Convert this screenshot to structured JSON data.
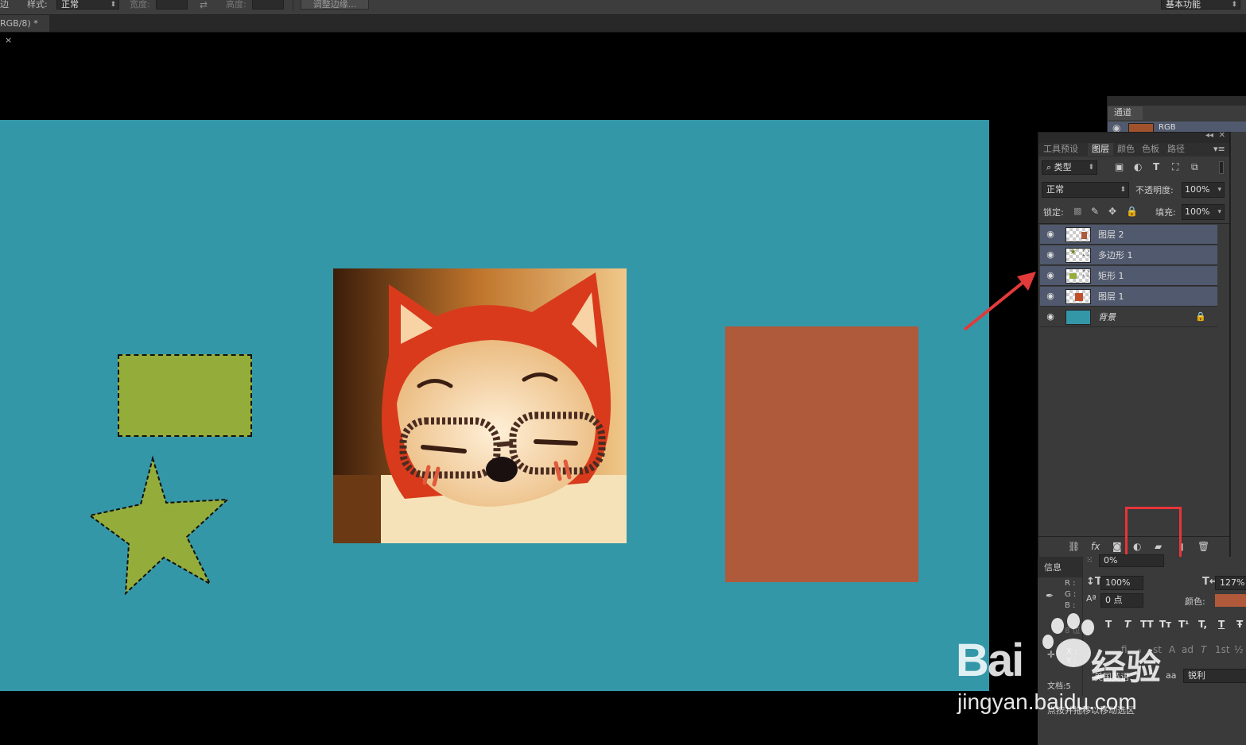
{
  "options_bar": {
    "fragment_left": "边",
    "style_label": "样式:",
    "style_value": "正常",
    "width_label": "宽度:",
    "height_label": "高度:",
    "refine_edge_button": "调整边缘...",
    "workspace_value": "基本功能"
  },
  "document_tab": {
    "title": "RGB/8) *",
    "close": "×"
  },
  "channels_panel": {
    "tab": "通道",
    "row_label": "RGB"
  },
  "layers_panel": {
    "tabs": [
      "工具预设",
      "图层",
      "颜色",
      "色板",
      "路径"
    ],
    "filter_label": "类型",
    "blend_mode": "正常",
    "opacity_label": "不透明度:",
    "opacity_value": "100%",
    "lock_label": "锁定:",
    "fill_label": "填充:",
    "fill_value": "100%",
    "layers": [
      {
        "name": "图层 2",
        "selected": true
      },
      {
        "name": "多边形 1",
        "selected": true
      },
      {
        "name": "矩形 1",
        "selected": true
      },
      {
        "name": "图层 1",
        "selected": true
      },
      {
        "name": "背景",
        "selected": false,
        "locked": true
      }
    ],
    "bottom_icons": [
      "link-icon",
      "fx-icon",
      "mask-icon",
      "adjustment-icon",
      "folder-icon",
      "new-layer-icon",
      "trash-icon"
    ],
    "fx_label": "fx"
  },
  "info_panel": {
    "tab": "信息",
    "r_label": "R :",
    "g_label": "G :",
    "b_label": "B :",
    "bit_label": "8 位",
    "x_label": "X :",
    "y_label": "Y :",
    "doc_label": "文档:5",
    "hint": "点按并拖移以移动选区"
  },
  "character_panel": {
    "tracking_value": "0%",
    "vscale_value": "100%",
    "hscale_value": "127%",
    "baseline_value": "0 点",
    "color_label": "颜色:",
    "color_swatch": "#b05a3b",
    "language": "美国英语",
    "aa_label": "aa",
    "antialias": "锐利",
    "style_buttons": [
      "T",
      "T",
      "TT",
      "Tт",
      "T¹",
      "T,",
      "T",
      "Ŧ"
    ],
    "opentype_buttons": [
      "ﬁ",
      "ℴ",
      "st",
      "A",
      "ad",
      "T",
      "1st",
      "½"
    ]
  },
  "canvas_colors": {
    "background": "#3497a8",
    "green_shape": "#94ad3a",
    "brown_rect": "#af5a3a"
  },
  "watermark": {
    "brand": "Bai",
    "brand_suffix": "经验",
    "url": "jingyan.baidu.com"
  }
}
